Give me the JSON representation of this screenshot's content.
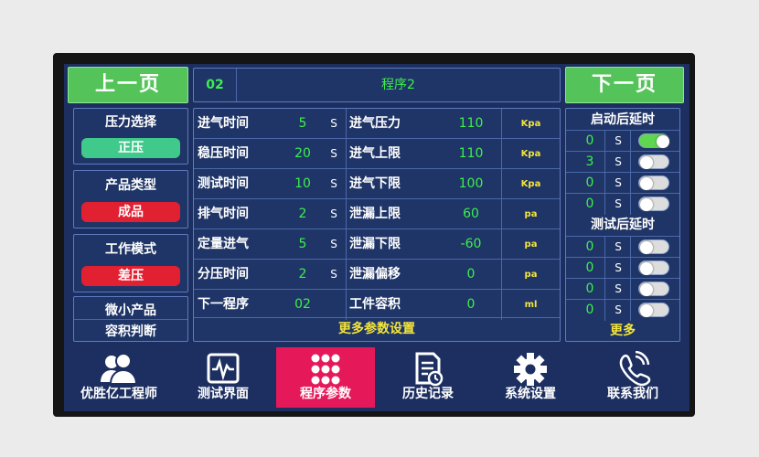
{
  "header": {
    "prev_label": "上一页",
    "next_label": "下一页",
    "program_number": "02",
    "program_title": "程序2"
  },
  "left": {
    "pressure_select": {
      "title": "压力选择",
      "value": "正压",
      "color": "#3fc98a"
    },
    "product_type": {
      "title": "产品类型",
      "value": "成品",
      "color": "#e12032"
    },
    "work_mode": {
      "title": "工作模式",
      "value": "差压",
      "color": "#e12032"
    },
    "micro": {
      "line1": "微小产品",
      "line2": "容积判断"
    }
  },
  "params_left": [
    {
      "label": "进气时间",
      "value": "5",
      "unit": "S"
    },
    {
      "label": "稳压时间",
      "value": "20",
      "unit": "S"
    },
    {
      "label": "测试时间",
      "value": "10",
      "unit": "S"
    },
    {
      "label": "排气时间",
      "value": "2",
      "unit": "S"
    },
    {
      "label": "定量进气",
      "value": "5",
      "unit": "S"
    },
    {
      "label": "分压时间",
      "value": "2",
      "unit": "S"
    },
    {
      "label": "下一程序",
      "value": "02",
      "unit": ""
    }
  ],
  "params_right": [
    {
      "label": "进气压力",
      "value": "110",
      "unit": "Kpa"
    },
    {
      "label": "进气上限",
      "value": "110",
      "unit": "Kpa"
    },
    {
      "label": "进气下限",
      "value": "100",
      "unit": "Kpa"
    },
    {
      "label": "泄漏上限",
      "value": "60",
      "unit": "pa"
    },
    {
      "label": "泄漏下限",
      "value": "-60",
      "unit": "pa"
    },
    {
      "label": "泄漏偏移",
      "value": "0",
      "unit": "pa"
    },
    {
      "label": "工件容积",
      "value": "0",
      "unit": "ml"
    }
  ],
  "more_params_label": "更多参数设置",
  "right": {
    "start_delay_title": "启动后延时",
    "start_delays": [
      {
        "value": "0",
        "unit": "S",
        "on": true
      },
      {
        "value": "3",
        "unit": "S",
        "on": false
      },
      {
        "value": "0",
        "unit": "S",
        "on": false
      },
      {
        "value": "0",
        "unit": "S",
        "on": false
      }
    ],
    "test_delay_title": "测试后延时",
    "test_delays": [
      {
        "value": "0",
        "unit": "S",
        "on": false
      },
      {
        "value": "0",
        "unit": "S",
        "on": false
      },
      {
        "value": "0",
        "unit": "S",
        "on": false
      },
      {
        "value": "0",
        "unit": "S",
        "on": false
      }
    ],
    "more_label": "更多"
  },
  "bottom_nav": [
    {
      "label": "优胜亿工程师",
      "icon": "engineer-icon",
      "active": false
    },
    {
      "label": "测试界面",
      "icon": "waveform-monitor-icon",
      "active": false
    },
    {
      "label": "程序参数",
      "icon": "grid-dots-icon",
      "active": true
    },
    {
      "label": "历史记录",
      "icon": "history-document-icon",
      "active": false
    },
    {
      "label": "系统设置",
      "icon": "gear-icon",
      "active": false
    },
    {
      "label": "联系我们",
      "icon": "phone-icon",
      "active": false
    }
  ],
  "colors": {
    "background": "#1c2f60",
    "nav_green": "#54c45a",
    "value_green": "#3cf04a",
    "unit_yellow": "#f4e53a",
    "active_tab": "#e5195a"
  }
}
